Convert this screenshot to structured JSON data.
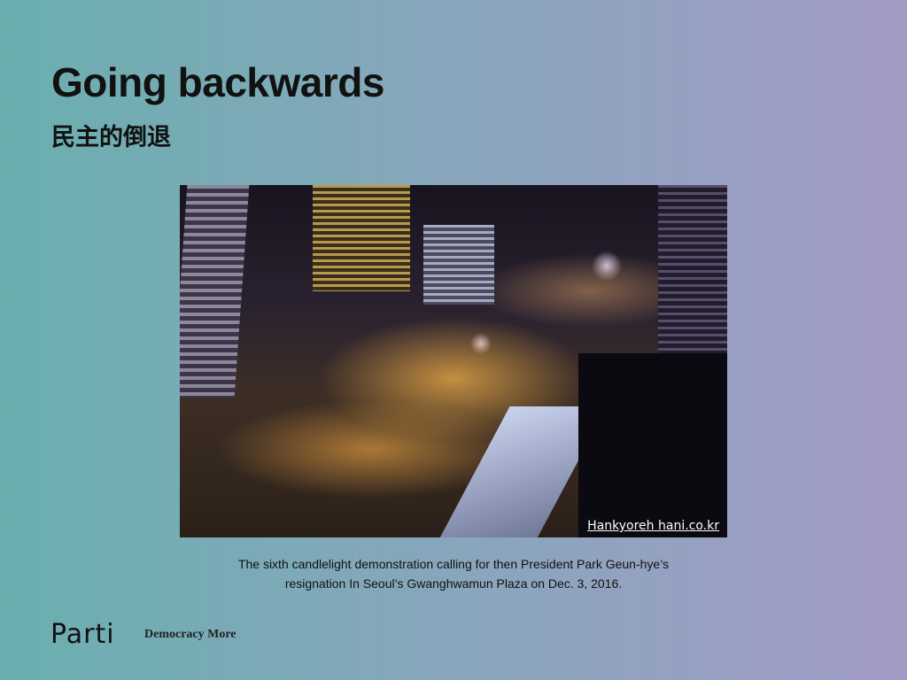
{
  "slide": {
    "title": "Going backwards",
    "subtitle": "民主的倒退",
    "photo": {
      "credit": "Hankyoreh hani.co.kr"
    },
    "caption_line1": "The sixth candlelight demonstration calling for then President Park Geun-hye’s",
    "caption_line2": "resignation In Seoul’s Gwanghwamun Plaza on Dec. 3, 2016."
  },
  "footer": {
    "logo": "Parti",
    "tagline": "Democracy More"
  }
}
